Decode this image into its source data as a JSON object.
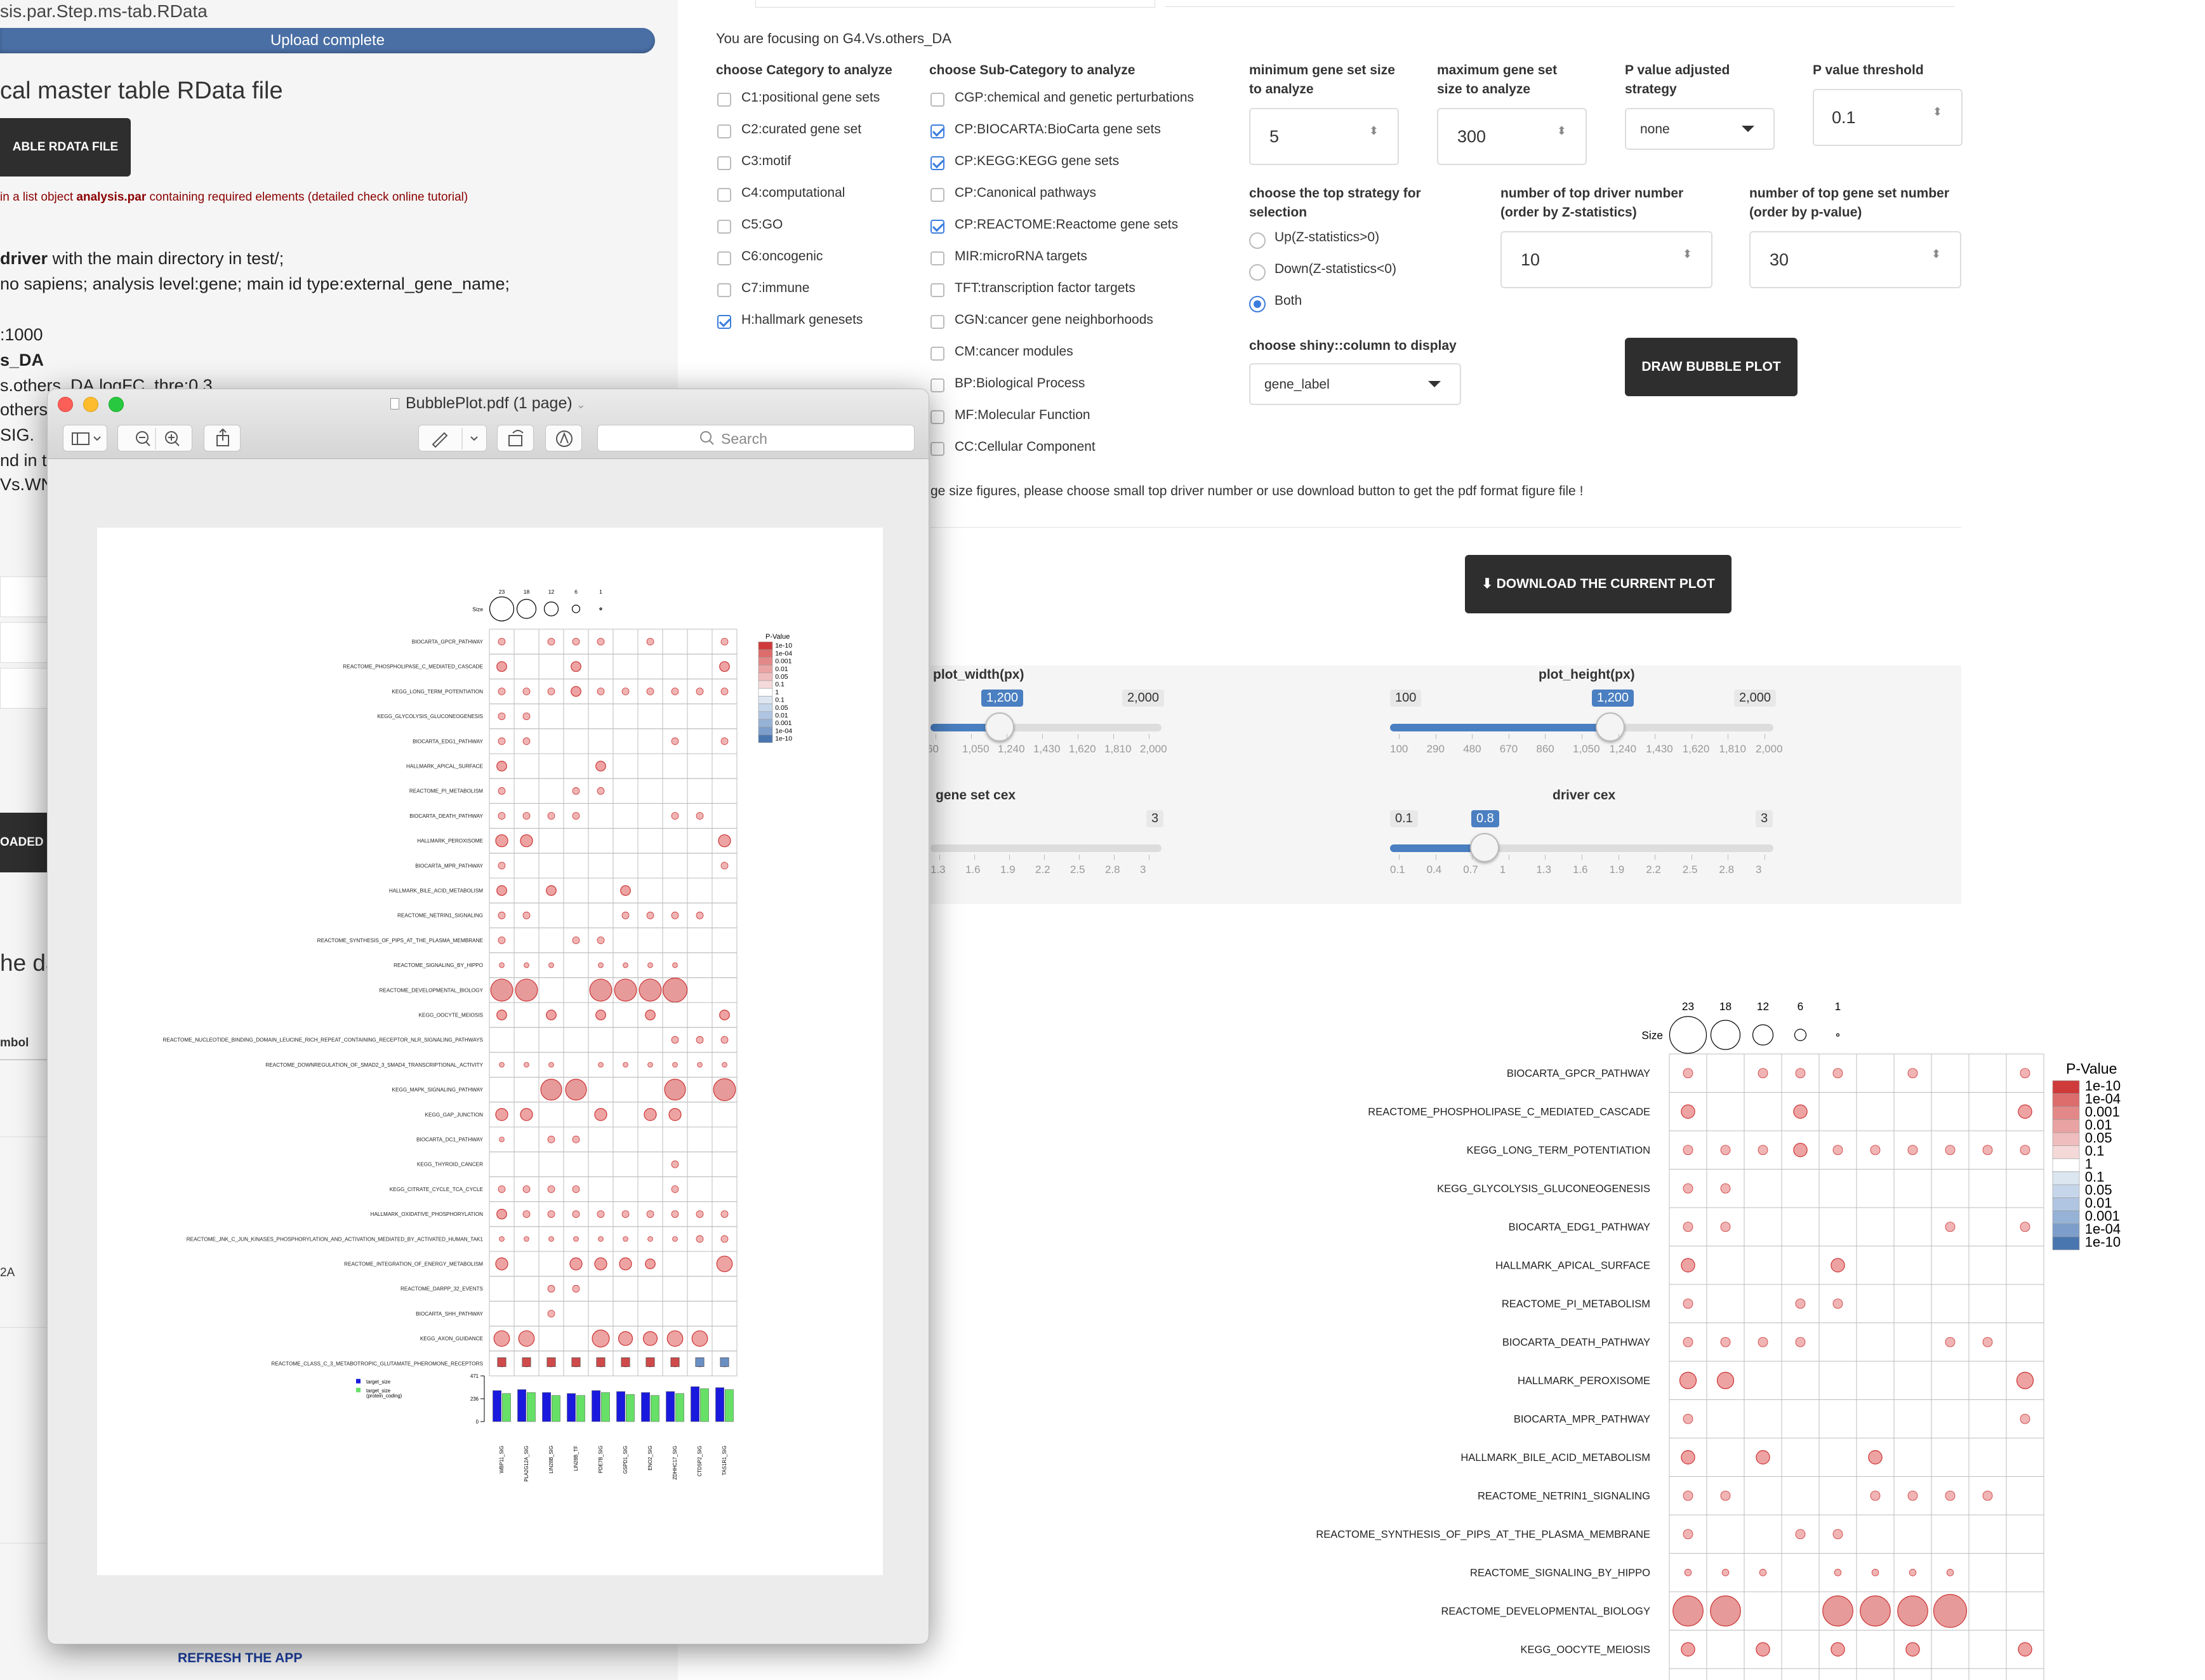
{
  "left": {
    "breadcrumb": "sis.par.Step.ms-tab.RData",
    "progress_text": "Upload complete",
    "progress": 1.0,
    "section_title": "cal master table RData file",
    "upload_button": "ABLE RDATA FILE",
    "note_prefix": "in a list object ",
    "note_bold": "analysis.par",
    "note_suffix": " containing required elements (detailed check online tutorial)",
    "line1_bold": "driver",
    "line1_rest": " with the main directory in test/;",
    "line2": "no sapiens; analysis level:gene; main id type:external_gene_name;",
    "line3": ":1000",
    "line4": "s_DA",
    "line5": "s.others_DA.logFC, thre:0.3",
    "line6": "others,",
    "line7": "SIG.",
    "line8": "nd in t",
    "line9": "Vs.WN",
    "loaded_button": "OADED I",
    "he_da": "he da",
    "table_col": "mbol",
    "row_2a": "2A",
    "refresh": "REFRESH THE APP"
  },
  "right": {
    "focus_text": "You are focusing on G4.Vs.others_DA",
    "cat_header": "choose Category to analyze",
    "categories": [
      {
        "label": "C1:positional gene sets",
        "checked": false
      },
      {
        "label": "C2:curated gene set",
        "checked": false
      },
      {
        "label": "C3:motif",
        "checked": false
      },
      {
        "label": "C4:computational",
        "checked": false
      },
      {
        "label": "C5:GO",
        "checked": false
      },
      {
        "label": "C6:oncogenic",
        "checked": false
      },
      {
        "label": "C7:immune",
        "checked": false
      },
      {
        "label": "H:hallmark genesets",
        "checked": true
      }
    ],
    "subcat_header": "choose Sub-Category to analyze",
    "subcategories": [
      {
        "label": "CGP:chemical and genetic perturbations",
        "checked": false
      },
      {
        "label": "CP:BIOCARTA:BioCarta gene sets",
        "checked": true
      },
      {
        "label": "CP:KEGG:KEGG gene sets",
        "checked": true
      },
      {
        "label": "CP:Canonical pathways",
        "checked": false
      },
      {
        "label": "CP:REACTOME:Reactome gene sets",
        "checked": true
      },
      {
        "label": "MIR:microRNA targets",
        "checked": false
      },
      {
        "label": "TFT:transcription factor targets",
        "checked": false
      },
      {
        "label": "CGN:cancer gene neighborhoods",
        "checked": false
      },
      {
        "label": "CM:cancer modules",
        "checked": false
      },
      {
        "label": "BP:Biological Process",
        "checked": false
      },
      {
        "label": "MF:Molecular Function",
        "checked": false
      },
      {
        "label": "CC:Cellular Component",
        "checked": false
      }
    ],
    "min_size_label_1": "minimum gene set size",
    "min_size_label_2": "to analyze",
    "min_size_value": "5",
    "max_size_label_1": "maximum gene set",
    "max_size_label_2": "size to analyze",
    "max_size_value": "300",
    "padj_label_1": "P value adjusted",
    "padj_label_2": "strategy",
    "padj_value": "none",
    "pthr_label": "P value threshold",
    "pthr_value": "0.1",
    "strategy_label_1": "choose the top strategy for",
    "strategy_label_2": "selection",
    "strategies": [
      {
        "label": "Up(Z-statistics>0)",
        "selected": false
      },
      {
        "label": "Down(Z-statistics<0)",
        "selected": false
      },
      {
        "label": "Both",
        "selected": true
      }
    ],
    "topdriver_label_1": "number of top driver number",
    "topdriver_label_2": "(order by Z-statistics)",
    "topdriver_value": "10",
    "topgs_label_1": "number of top gene set number",
    "topgs_label_2": "(order by p-value)",
    "topgs_value": "30",
    "column_label": "choose shiny::column to display",
    "column_value": "gene_label",
    "draw_button": "DRAW BUBBLE PLOT",
    "warning": "ge size figures, please choose small top driver number or use download button to get the pdf format figure file !",
    "download_button": "DOWNLOAD THE CURRENT PLOT",
    "plot_width_label": "plot_width(px)",
    "plot_width_value": "1,200",
    "plot_width_max": "2,000",
    "plot_width_ticks": [
      "60",
      "1,050",
      "1,240",
      "1,430",
      "1,620",
      "1,810",
      "2,000"
    ],
    "plot_height_label": "plot_height(px)",
    "plot_height_min": "100",
    "plot_height_value": "1,200",
    "plot_height_max": "2,000",
    "plot_height_ticks": [
      "100",
      "290",
      "480",
      "670",
      "860",
      "1,050",
      "1,240",
      "1,430",
      "1,620",
      "1,810",
      "2,000"
    ],
    "gs_cex_label": "gene set cex",
    "gs_cex_max": "3",
    "gs_cex_ticks": [
      "1.3",
      "1.6",
      "1.9",
      "2.2",
      "2.5",
      "2.8",
      "3"
    ],
    "drv_cex_label": "driver cex",
    "drv_cex_min": "0.1",
    "drv_cex_value": "0.8",
    "drv_cex_max": "3",
    "drv_cex_ticks": [
      "0.1",
      "0.4",
      "0.7",
      "1",
      "1.3",
      "1.6",
      "1.9",
      "2.2",
      "2.5",
      "2.8",
      "3"
    ]
  },
  "pdf_window": {
    "title": "BubblePlot.pdf (1 page)",
    "search_placeholder": "Search"
  },
  "chart_data": {
    "type": "bubble",
    "size_label": "Size",
    "size_legend": [
      "23",
      "18",
      "12",
      "6",
      "1"
    ],
    "pvalue_title": "P-Value",
    "pvalue_legend": [
      "1e-10",
      "1e-04",
      "0.001",
      "0.01",
      "0.05",
      "0.1",
      "1",
      "0.1",
      "0.05",
      "0.01",
      "0.001",
      "1e-04",
      "1e-10"
    ],
    "pvalue_colors": [
      "#cf3b3b",
      "#dd6c6c",
      "#e38888",
      "#e9a3a3",
      "#efbdbd",
      "#f5d9d9",
      "#ffffff",
      "#dbe6f1",
      "#c6d6ea",
      "#b0c5e1",
      "#96b2d6",
      "#7d9ecb",
      "#4a76b0"
    ],
    "gene_sets": [
      "BIOCARTA_GPCR_PATHWAY",
      "REACTOME_PHOSPHOLIPASE_C_MEDIATED_CASCADE",
      "KEGG_LONG_TERM_POTENTIATION",
      "KEGG_GLYCOLYSIS_GLUCONEOGENESIS",
      "BIOCARTA_EDG1_PATHWAY",
      "HALLMARK_APICAL_SURFACE",
      "REACTOME_PI_METABOLISM",
      "BIOCARTA_DEATH_PATHWAY",
      "HALLMARK_PEROXISOME",
      "BIOCARTA_MPR_PATHWAY",
      "HALLMARK_BILE_ACID_METABOLISM",
      "REACTOME_NETRIN1_SIGNALING",
      "REACTOME_SYNTHESIS_OF_PIPS_AT_THE_PLASMA_MEMBRANE",
      "REACTOME_SIGNALING_BY_HIPPO",
      "REACTOME_DEVELOPMENTAL_BIOLOGY",
      "KEGG_OOCYTE_MEIOSIS",
      "REACTOME_NUCLEOTIDE_BINDING_DOMAIN_LEUCINE_RICH_REPEAT_CONTAINING_RECEPTOR_NLR_SIGNALING_PATHWAYS",
      "REACTOME_DOWNREGULATION_OF_SMAD2_3_SMAD4_TRANSCRIPTIONAL_ACTIVITY",
      "KEGG_MAPK_SIGNALING_PATHWAY",
      "KEGG_GAP_JUNCTION",
      "BIOCARTA_DC1_PATHWAY",
      "KEGG_THYROID_CANCER",
      "KEGG_CITRATE_CYCLE_TCA_CYCLE",
      "HALLMARK_OXIDATIVE_PHOSPHORYLATION",
      "REACTOME_JNK_C_JUN_KINASES_PHOSPHORYLATION_AND_ACTIVATION_MEDIATED_BY_ACTIVATED_HUMAN_TAK1",
      "REACTOME_INTEGRATION_OF_ENERGY_METABOLISM",
      "REACTOME_DARPP_32_EVENTS",
      "BIOCARTA_SHH_PATHWAY",
      "KEGG_AXON_GUIDANCE",
      "REACTOME_CLASS_C_3_METABOTROPIC_GLUTAMATE_PHEROMONE_RECEPTORS"
    ],
    "drivers": [
      "WBP11_SIG",
      "PLA2G12A_SIG",
      "LIN28B_SIG",
      "LIN28B_TF",
      "PDE7B_SIG",
      "GSPD1_SIG",
      "ENO2_SIG",
      "ZDHHC17_SIG",
      "CTDSP2_SIG",
      "TAS1R1_SIG"
    ],
    "matrix": [
      [
        1,
        0,
        1,
        1,
        1,
        0,
        1,
        0,
        0,
        1
      ],
      [
        2,
        0,
        0,
        2,
        0,
        0,
        0,
        0,
        0,
        2
      ],
      [
        1,
        1,
        1,
        2,
        1,
        1,
        1,
        1,
        1,
        1
      ],
      [
        1,
        1,
        0,
        0,
        0,
        0,
        0,
        0,
        0,
        0
      ],
      [
        1,
        1,
        0,
        0,
        0,
        0,
        0,
        1,
        0,
        1
      ],
      [
        2,
        0,
        0,
        0,
        2,
        0,
        0,
        0,
        0,
        0
      ],
      [
        1,
        0,
        0,
        1,
        1,
        0,
        0,
        0,
        0,
        0
      ],
      [
        1,
        1,
        1,
        1,
        0,
        0,
        0,
        1,
        1,
        0
      ],
      [
        3,
        3,
        0,
        0,
        0,
        0,
        0,
        0,
        0,
        3
      ],
      [
        1,
        0,
        0,
        0,
        0,
        0,
        0,
        0,
        0,
        1
      ],
      [
        2,
        0,
        2,
        0,
        0,
        2,
        0,
        0,
        0,
        0
      ],
      [
        1,
        1,
        0,
        0,
        0,
        1,
        1,
        1,
        1,
        0
      ],
      [
        1,
        0,
        0,
        1,
        1,
        0,
        0,
        0,
        0,
        0
      ],
      [
        0.5,
        0.5,
        0.5,
        0,
        0.5,
        0.5,
        0.5,
        0.5,
        0,
        0
      ],
      [
        10,
        10,
        0,
        0,
        10,
        10,
        10,
        12,
        0,
        0
      ],
      [
        2,
        0,
        2,
        0,
        2,
        0,
        2,
        0,
        0,
        2
      ],
      [
        0,
        0,
        0,
        0,
        0,
        0,
        0,
        1,
        1,
        1
      ],
      [
        0.5,
        0.5,
        0.5,
        0,
        0.5,
        0.5,
        0.5,
        0.5,
        0.5,
        0.5
      ],
      [
        0,
        0,
        9,
        9,
        0,
        0,
        0,
        9,
        0,
        10
      ],
      [
        3,
        3,
        0,
        0,
        3,
        0,
        3,
        3,
        0,
        0
      ],
      [
        0.5,
        0,
        1,
        1,
        0,
        0,
        0,
        0,
        0,
        0
      ],
      [
        0,
        0,
        0,
        0,
        0,
        0,
        0,
        1,
        0,
        0
      ],
      [
        1,
        1,
        1,
        1,
        0,
        0,
        0,
        1,
        0,
        0
      ],
      [
        2,
        1,
        1,
        1,
        1,
        1,
        1,
        1,
        1,
        1
      ],
      [
        0.5,
        0.5,
        0.5,
        0.5,
        0.5,
        0.5,
        0.5,
        0.5,
        1,
        1
      ],
      [
        3,
        0,
        0,
        3,
        3,
        3,
        2,
        0,
        0,
        5
      ],
      [
        0,
        0,
        1,
        1,
        0,
        0,
        0,
        0,
        0,
        0
      ],
      [
        0,
        0,
        1,
        0,
        0,
        0,
        0,
        0,
        0,
        0
      ],
      [
        5,
        5,
        0,
        0,
        6,
        4,
        4,
        5,
        5,
        0
      ],
      [
        1,
        1,
        1,
        1,
        1,
        1,
        1,
        1,
        1,
        1
      ]
    ],
    "target_size_label": "target_size",
    "target_size_pc_label": "target_size\n(protein_coding)",
    "bar_ticks": [
      "471",
      "236",
      "0"
    ],
    "bar_ymax": 471,
    "target_size": [
      320,
      330,
      300,
      290,
      320,
      310,
      300,
      310,
      360,
      350
    ],
    "target_size_pc": [
      290,
      300,
      270,
      270,
      300,
      280,
      270,
      290,
      340,
      330
    ]
  }
}
